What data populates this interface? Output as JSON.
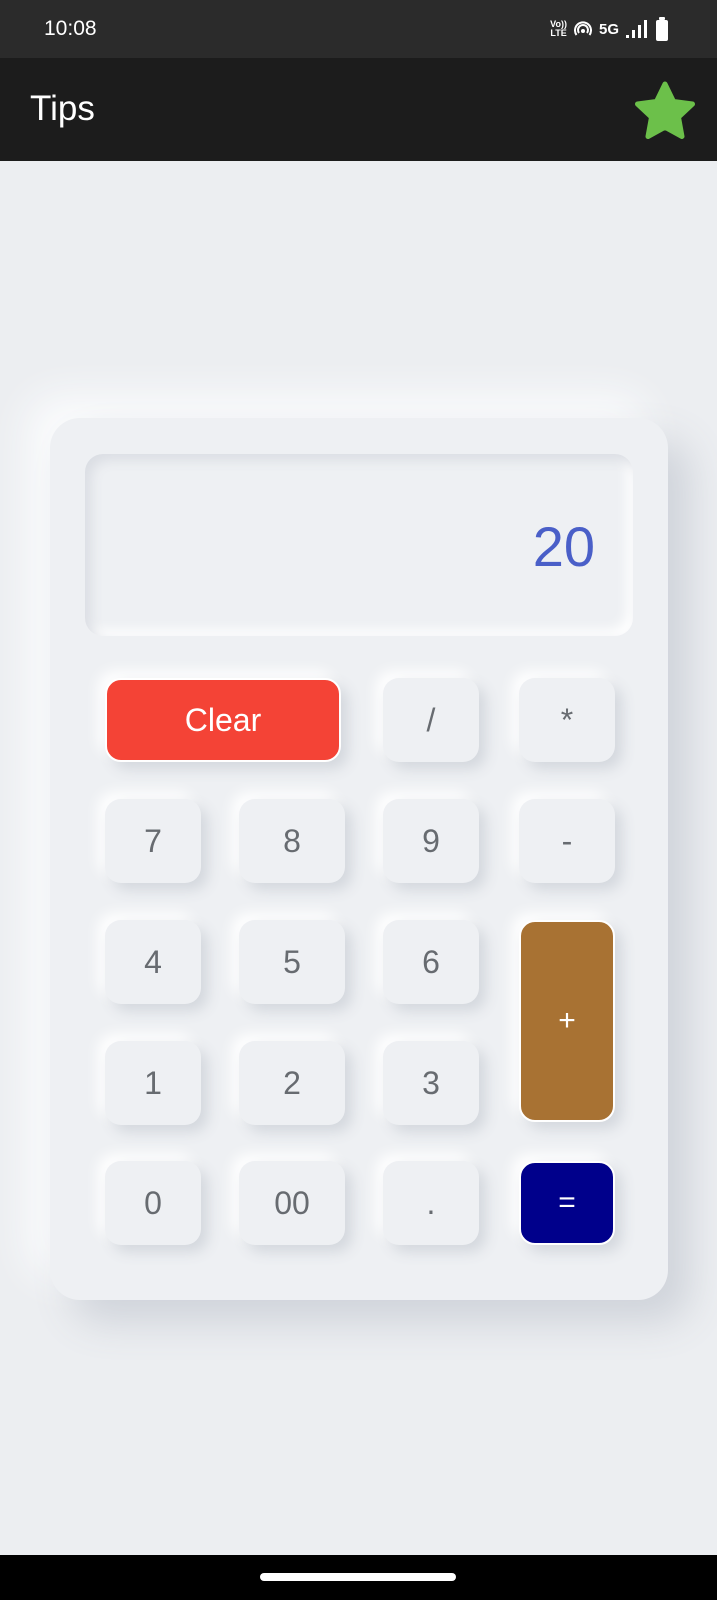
{
  "status_bar": {
    "time": "10:08",
    "volte_top": "Vo))",
    "volte_bottom": "LTE",
    "network": "5G",
    "icons": [
      "volte-icon",
      "hotspot-icon",
      "signal-icon",
      "battery-icon"
    ]
  },
  "app_bar": {
    "title": "Tips",
    "action_icon": "star-icon",
    "star_color": "#6cc04a"
  },
  "calculator": {
    "display_value": "20",
    "keys": {
      "clear": "Clear",
      "divide": "/",
      "multiply": "*",
      "seven": "7",
      "eight": "8",
      "nine": "9",
      "minus": "-",
      "four": "4",
      "five": "5",
      "six": "6",
      "plus": "+",
      "one": "1",
      "two": "2",
      "three": "3",
      "zero": "0",
      "double_zero": "00",
      "dot": ".",
      "equals": "="
    },
    "colors": {
      "clear": "#f44336",
      "plus": "#a87233",
      "equals": "#00008b",
      "display_text": "#4a5fc8"
    }
  }
}
